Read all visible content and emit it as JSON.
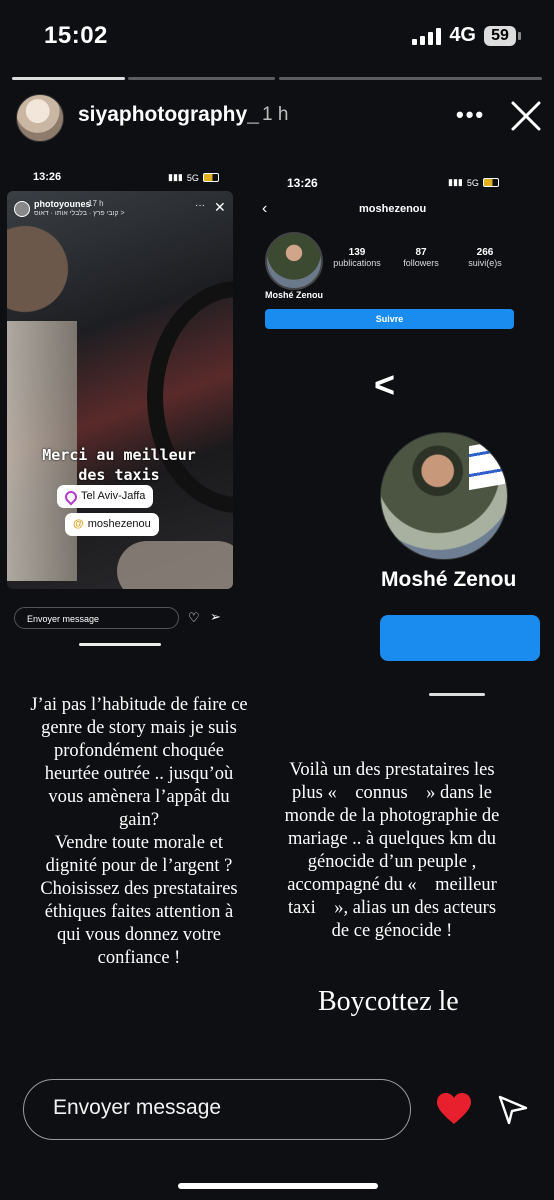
{
  "status_bar": {
    "time": "15:02",
    "network": "4G",
    "battery": "59"
  },
  "story_progress": {
    "segments": 3,
    "active": 1,
    "active_fill": 1.0
  },
  "header": {
    "username": "siyaphotography_",
    "age": "1 h"
  },
  "left_screenshot": {
    "status_time": "13:26",
    "status_network": "5G",
    "username": "photoyounes",
    "age": "17 h",
    "location_line": "קובי פרץ · בלבלי אותו · דאוס >",
    "caption_line1": "Merci au meilleur",
    "caption_line2": "des taxis",
    "location_sticker": "Tel Aviv-Jaffa",
    "mention_sticker": "moshezenou",
    "message_placeholder": "Envoyer message"
  },
  "right_screenshot": {
    "status_time": "13:26",
    "status_network": "5G",
    "username": "moshezenou",
    "stats": [
      {
        "value": "139",
        "label": "publications"
      },
      {
        "value": "87",
        "label": "followers"
      },
      {
        "value": "266",
        "label": "suivi(e)s"
      }
    ],
    "profile_name": "Moshé Zenou",
    "follow_button": "Suivre",
    "profile_name_large": "Moshé Zenou"
  },
  "text_left": [
    "J’ai pas l’habitude de faire ce",
    "genre de story mais je suis",
    "profondément choquée",
    "heurtée outrée .. jusqu’où",
    "vous amènera l’appât du",
    "gain?",
    "Vendre toute morale et",
    "dignité pour de l’argent ?",
    "Choisissez des prestataires",
    "éthiques faites attention à",
    "qui vous donnez votre",
    "confiance !"
  ],
  "text_right": [
    "Voilà un des prestataires les",
    "plus «    connus    » dans le",
    "monde de la photographie de",
    "mariage .. à quelques km du",
    "génocide d’un peuple ,",
    "accompagné du «    meilleur",
    "taxi    », alias un des acteurs",
    "de ce génocide !"
  ],
  "boycott_text": "Boycottez le",
  "bottom_bar": {
    "message_placeholder": "Envoyer message"
  },
  "colors": {
    "background": "#0d0f12",
    "accent_blue": "#1a8cf0",
    "heart": "#e8202e"
  }
}
